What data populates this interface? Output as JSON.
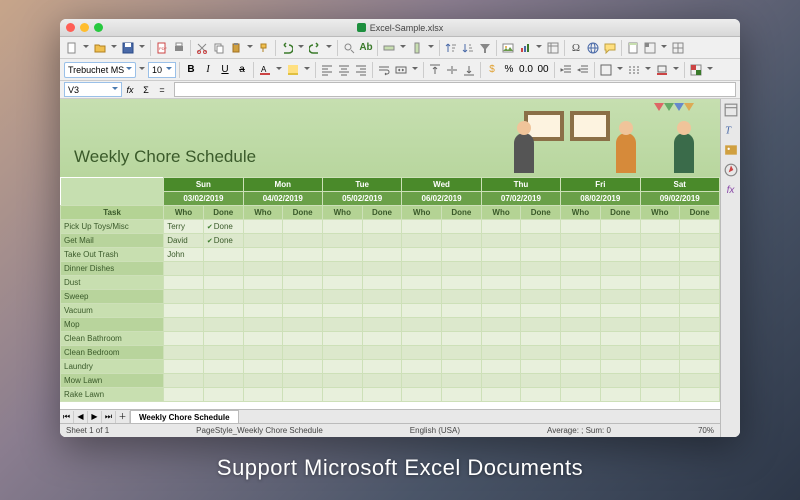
{
  "caption": "Support Microsoft Excel Documents",
  "window": {
    "filename": "Excel-Sample.xlsx"
  },
  "toolbar2": {
    "font_name": "Trebuchet MS",
    "font_size": "10",
    "bold": "B",
    "italic": "I",
    "underline": "U",
    "strike": "a",
    "percent": "%",
    "decimal": "0.0",
    "thousands": "00"
  },
  "formula": {
    "cell_ref": "V3",
    "fx": "fx",
    "sigma": "Σ",
    "eq": "="
  },
  "sheet": {
    "title": "Weekly Chore Schedule",
    "task_header": "Task",
    "who_label": "Who",
    "done_label": "Done",
    "days": [
      {
        "name": "Sun",
        "date": "03/02/2019"
      },
      {
        "name": "Mon",
        "date": "04/02/2019"
      },
      {
        "name": "Tue",
        "date": "05/02/2019"
      },
      {
        "name": "Wed",
        "date": "06/02/2019"
      },
      {
        "name": "Thu",
        "date": "07/02/2019"
      },
      {
        "name": "Fri",
        "date": "08/02/2019"
      },
      {
        "name": "Sat",
        "date": "09/02/2019"
      }
    ],
    "tasks": [
      {
        "name": "Pick Up Toys/Misc",
        "sun_who": "Terry",
        "sun_done": "Done"
      },
      {
        "name": "Get Mail",
        "sun_who": "David",
        "sun_done": "Done"
      },
      {
        "name": "Take Out Trash",
        "sun_who": "John"
      },
      {
        "name": "Dinner Dishes"
      },
      {
        "name": "Dust"
      },
      {
        "name": "Sweep"
      },
      {
        "name": "Vacuum"
      },
      {
        "name": "Mop"
      },
      {
        "name": "Clean Bathroom"
      },
      {
        "name": "Clean Bedroom"
      },
      {
        "name": "Laundry"
      },
      {
        "name": "Mow Lawn"
      },
      {
        "name": "Rake Lawn"
      }
    ]
  },
  "tabs": {
    "sheet_tab": "Weekly Chore Schedule"
  },
  "status": {
    "sheet_count": "Sheet 1 of 1",
    "page_style": "PageStyle_Weekly Chore Schedule",
    "language": "English (USA)",
    "summary": "Average: ; Sum: 0",
    "zoom": "70%"
  }
}
